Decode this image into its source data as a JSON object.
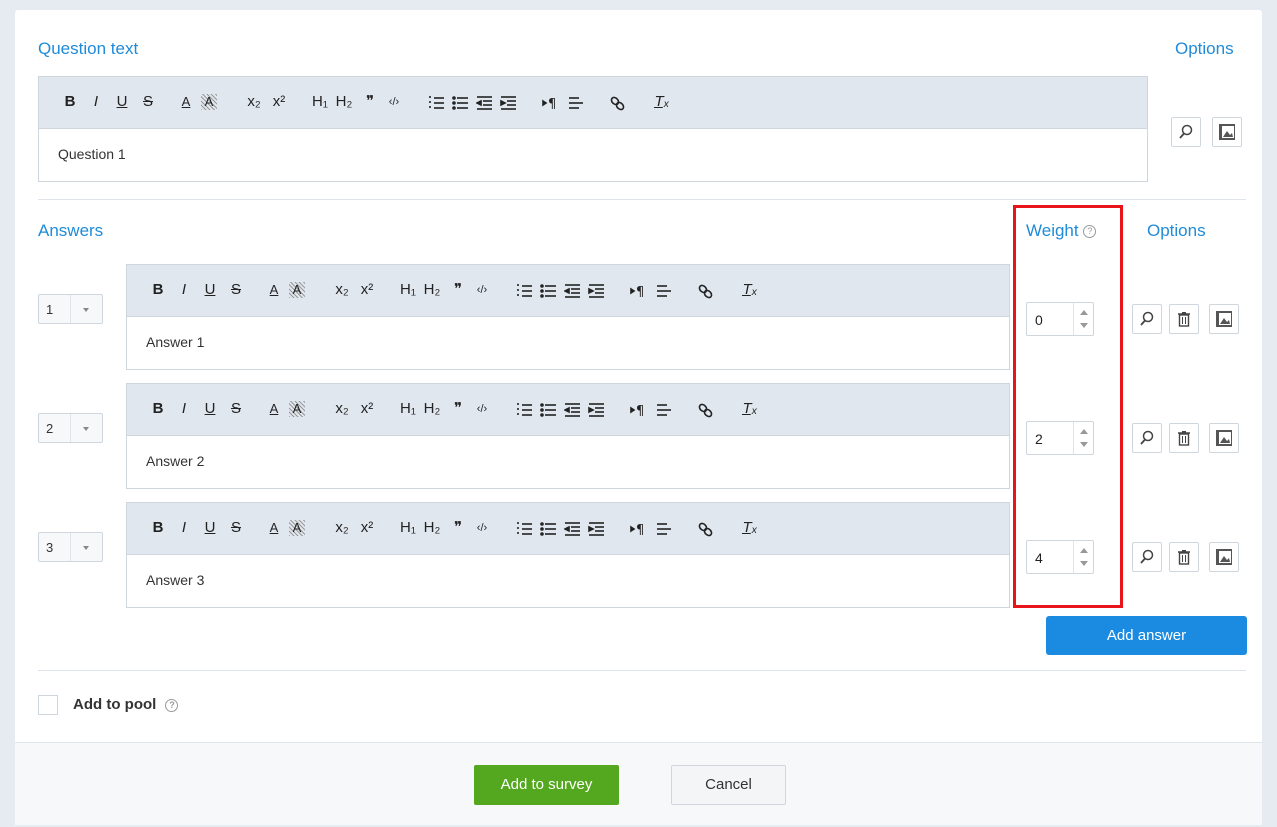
{
  "question": {
    "section_title": "Question text",
    "options_label": "Options",
    "text": "Question 1"
  },
  "toolbar": {
    "bold": "B",
    "italic": "I",
    "underline": "U",
    "strike": "S",
    "text_color": "A",
    "bg_color": "A",
    "subscript": "x₂",
    "superscript": "x²",
    "h1": "H₁",
    "h2": "H₂",
    "quote": "❞",
    "code": "‹/›",
    "clear_format": "T̲ₓ"
  },
  "answers": {
    "section_title": "Answers",
    "weight_label": "Weight",
    "options_label": "Options",
    "items": [
      {
        "number": "1",
        "text": "Answer 1",
        "weight": "0"
      },
      {
        "number": "2",
        "text": "Answer 2",
        "weight": "2"
      },
      {
        "number": "3",
        "text": "Answer 3",
        "weight": "4"
      }
    ],
    "add_button": "Add answer"
  },
  "pool": {
    "label": "Add to pool"
  },
  "footer": {
    "add_label": "Add to survey",
    "cancel_label": "Cancel"
  },
  "colors": {
    "accent": "#1f8bd9",
    "primary_button": "#1a8be0",
    "submit_button": "#53a81f",
    "highlight": "#e8141a"
  }
}
